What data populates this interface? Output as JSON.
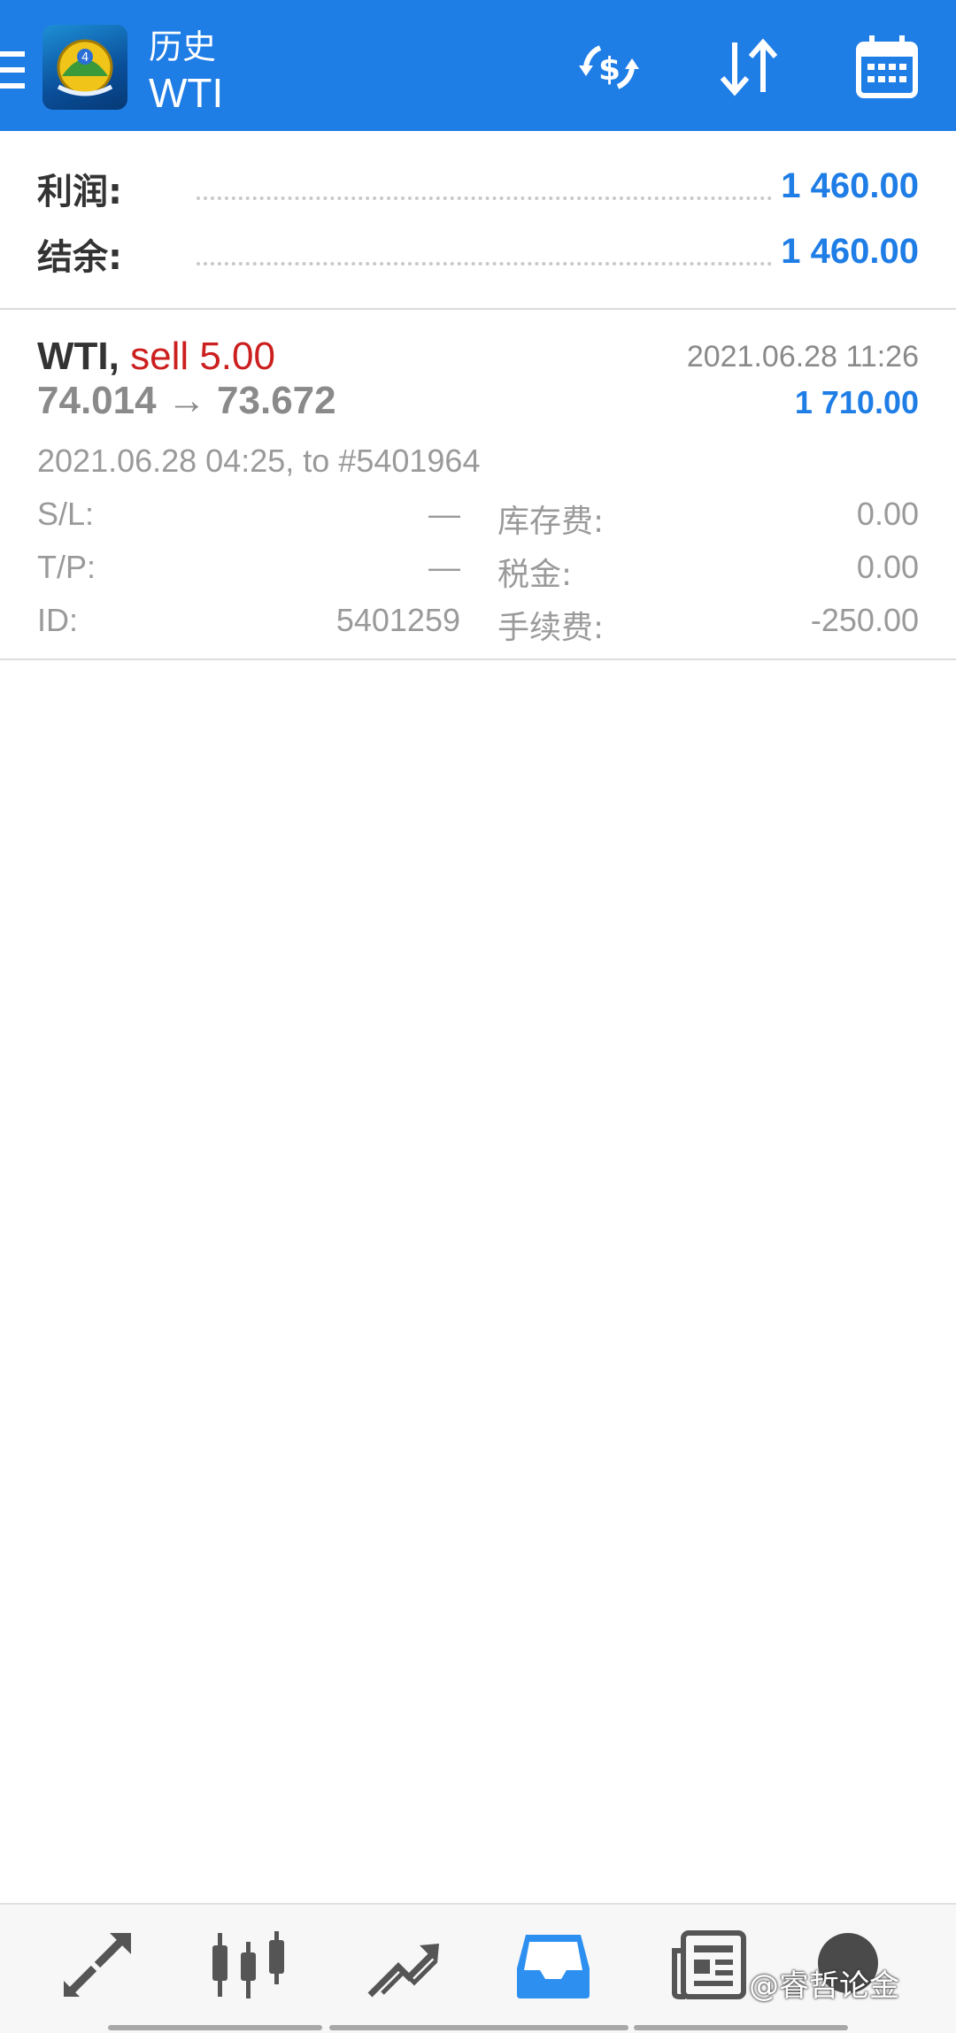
{
  "header": {
    "title": "历史",
    "subtitle": "WTI",
    "icons": [
      "menu-icon",
      "app-logo",
      "currency-exchange-icon",
      "sort-icon",
      "calendar-icon"
    ]
  },
  "summary": {
    "profit_label": "利润:",
    "profit_value": "1 460.00",
    "balance_label": "结余:",
    "balance_value": "1 460.00"
  },
  "deal": {
    "symbol": "WTI,",
    "side": "sell 5.00",
    "close_time": "2021.06.28 11:26",
    "open_price": "74.014",
    "arrow": "→",
    "close_price": "73.672",
    "profit": "1 710.00",
    "open_info": "2021.06.28 04:25, to #5401964",
    "rows": [
      {
        "k1": "S/L:",
        "v1": "—",
        "k2": "库存费:",
        "v2": "0.00"
      },
      {
        "k1": "T/P:",
        "v1": "—",
        "k2": "税金:",
        "v2": "0.00"
      },
      {
        "k1": "ID:",
        "v1": "5401259",
        "k2": "手续费:",
        "v2": "-250.00"
      }
    ]
  },
  "bottom_nav": {
    "items": [
      "quotes-icon",
      "chart-icon",
      "trade-icon",
      "history-icon",
      "news-icon",
      "chat-icon"
    ],
    "active": "history-icon",
    "watermark": "@睿哲论金"
  },
  "colors": {
    "appbar": "#1f7de6",
    "profit": "#1f7de6",
    "sell": "#cc1f1f",
    "muted": "#9a9a9a"
  }
}
